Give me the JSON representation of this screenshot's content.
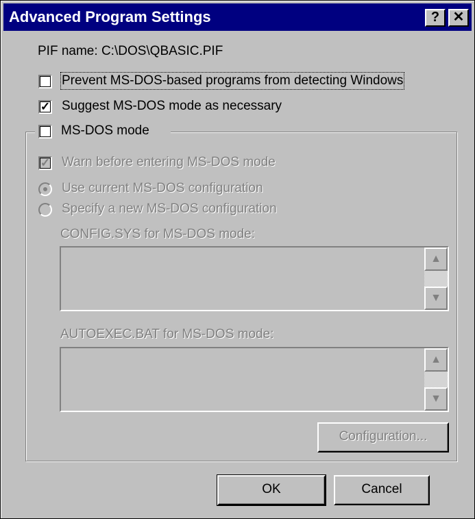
{
  "dialog": {
    "title": "Advanced Program Settings",
    "help_button": "?",
    "close_button": "✕"
  },
  "pif": {
    "label": "PIF name:",
    "value": "C:\\DOS\\QBASIC.PIF"
  },
  "options": {
    "prevent_detect": {
      "label": "Prevent MS-DOS-based programs from detecting Windows",
      "checked": false
    },
    "suggest_mode": {
      "label": "Suggest MS-DOS mode as necessary",
      "checked": true
    },
    "msdos_mode": {
      "label": "MS-DOS mode",
      "checked": false
    }
  },
  "msdos_group": {
    "warn": {
      "label": "Warn before entering MS-DOS mode",
      "checked": true
    },
    "use_current": {
      "label": "Use current MS-DOS configuration",
      "selected": true
    },
    "specify_new": {
      "label": "Specify a new MS-DOS configuration",
      "selected": false
    },
    "config_sys_label": "CONFIG.SYS for MS-DOS mode:",
    "autoexec_label": "AUTOEXEC.BAT for MS-DOS mode:",
    "configuration_button": "Configuration..."
  },
  "buttons": {
    "ok": "OK",
    "cancel": "Cancel"
  },
  "icons": {
    "scroll_up": "up-arrow-icon",
    "scroll_down": "down-arrow-icon"
  },
  "colors": {
    "titlebar": "#000080",
    "face": "#c0c0c0",
    "disabled_text": "#808080"
  }
}
